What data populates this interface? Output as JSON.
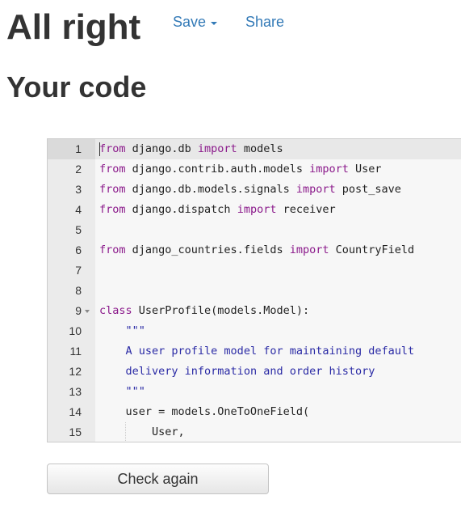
{
  "header": {
    "title": "All right",
    "save_label": "Save",
    "share_label": "Share"
  },
  "subtitle": "Your code",
  "editor": {
    "active_line": 1,
    "lines": [
      {
        "number": "1",
        "tokens": [
          {
            "t": "from",
            "k": "kw"
          },
          {
            "t": " django.db ",
            "k": ""
          },
          {
            "t": "import",
            "k": "kw"
          },
          {
            "t": " models",
            "k": ""
          }
        ]
      },
      {
        "number": "2",
        "tokens": [
          {
            "t": "from",
            "k": "kw"
          },
          {
            "t": " django.contrib.auth.models ",
            "k": ""
          },
          {
            "t": "import",
            "k": "kw"
          },
          {
            "t": " User",
            "k": ""
          }
        ]
      },
      {
        "number": "3",
        "tokens": [
          {
            "t": "from",
            "k": "kw"
          },
          {
            "t": " django.db.models.signals ",
            "k": ""
          },
          {
            "t": "import",
            "k": "kw"
          },
          {
            "t": " post_save",
            "k": ""
          }
        ]
      },
      {
        "number": "4",
        "tokens": [
          {
            "t": "from",
            "k": "kw"
          },
          {
            "t": " django.dispatch ",
            "k": ""
          },
          {
            "t": "import",
            "k": "kw"
          },
          {
            "t": " receiver",
            "k": ""
          }
        ]
      },
      {
        "number": "5",
        "tokens": []
      },
      {
        "number": "6",
        "tokens": [
          {
            "t": "from",
            "k": "kw"
          },
          {
            "t": " django_countries.fields ",
            "k": ""
          },
          {
            "t": "import",
            "k": "kw"
          },
          {
            "t": " CountryField",
            "k": ""
          }
        ]
      },
      {
        "number": "7",
        "tokens": []
      },
      {
        "number": "8",
        "tokens": []
      },
      {
        "number": "9",
        "fold": true,
        "tokens": [
          {
            "t": "class",
            "k": "kw"
          },
          {
            "t": " UserProfile(models.Model):",
            "k": ""
          }
        ]
      },
      {
        "number": "10",
        "tokens": [
          {
            "t": "    ",
            "k": ""
          },
          {
            "t": "\"\"\"",
            "k": "str"
          }
        ]
      },
      {
        "number": "11",
        "tokens": [
          {
            "t": "    ",
            "k": ""
          },
          {
            "t": "A user profile model for maintaining default",
            "k": "str"
          }
        ]
      },
      {
        "number": "12",
        "tokens": [
          {
            "t": "    ",
            "k": ""
          },
          {
            "t": "delivery information and order history",
            "k": "str"
          }
        ]
      },
      {
        "number": "13",
        "tokens": [
          {
            "t": "    ",
            "k": ""
          },
          {
            "t": "\"\"\"",
            "k": "str"
          }
        ]
      },
      {
        "number": "14",
        "tokens": [
          {
            "t": "    user = models.OneToOneField(",
            "k": ""
          }
        ]
      },
      {
        "number": "15",
        "guide": true,
        "tokens": [
          {
            "t": "        User,",
            "k": ""
          }
        ]
      }
    ]
  },
  "check_button_label": "Check again",
  "colors": {
    "link": "#337ab7",
    "keyword": "#8b1a8b",
    "string": "#2a2aa5"
  }
}
